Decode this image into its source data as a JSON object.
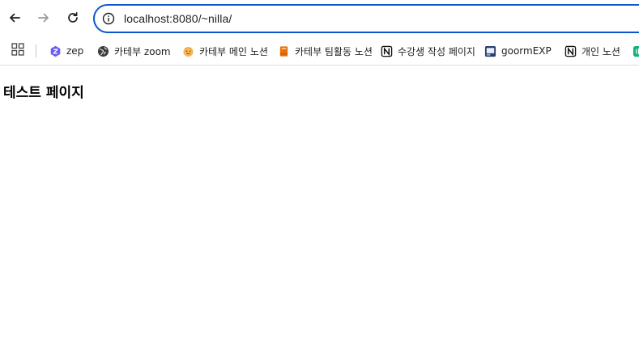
{
  "toolbar": {
    "back_label": "Back",
    "forward_label": "Forward",
    "reload_label": "Reload",
    "url": "localhost:8080/~nilla/"
  },
  "bookmarks": [
    {
      "label": "zep",
      "icon": "zep-icon"
    },
    {
      "label": "카테부 zoom",
      "icon": "globe-icon"
    },
    {
      "label": "카테부 메인 노션",
      "icon": "face-icon"
    },
    {
      "label": "카테부 팀활동 노션",
      "icon": "bookmark-orange-icon"
    },
    {
      "label": "수강생 작성 페이지",
      "icon": "notion-icon"
    },
    {
      "label": "goormEXP",
      "icon": "goorm-icon"
    },
    {
      "label": "개인 노션",
      "icon": "notion-icon"
    }
  ],
  "page": {
    "heading": "테스트 페이지"
  },
  "colors": {
    "accent": "#0b57d0",
    "zep": "#6b5cf5",
    "orange": "#e8710a"
  }
}
